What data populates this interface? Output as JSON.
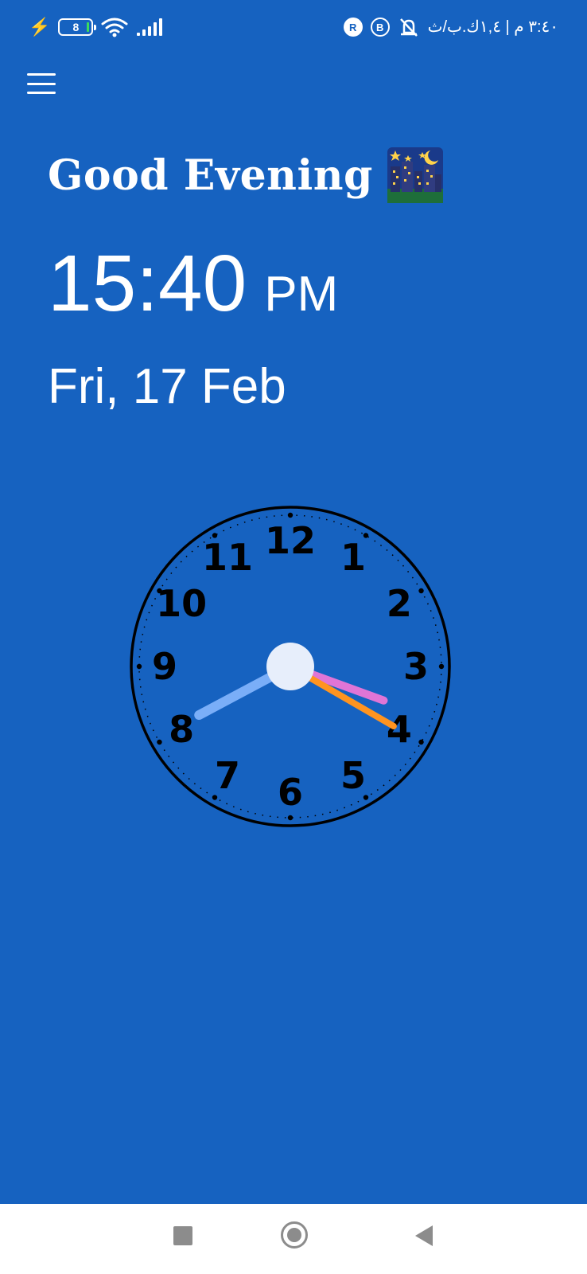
{
  "status_bar": {
    "battery_level": "8",
    "right_text": "٣:٤٠ م | ١,٤ك.ب/ث",
    "icons_left": [
      "charging-bolt-icon",
      "battery-icon",
      "wifi-icon",
      "cellular-signal-icon"
    ],
    "icons_right": [
      "muted-icon",
      "b-app-icon",
      "r-app-icon"
    ],
    "b_badge": "B",
    "r_badge": "R"
  },
  "header": {
    "menu_icon": "hamburger-menu-icon"
  },
  "greeting": {
    "text": "Good Evening",
    "emoji_icon": "night-city-icon"
  },
  "time": {
    "value": "15:40",
    "period": "PM"
  },
  "date": {
    "text": "Fri, 17 Feb"
  },
  "clock": {
    "hours": 15,
    "minutes": 40,
    "seconds": 20,
    "numbers": [
      "12",
      "1",
      "2",
      "3",
      "4",
      "5",
      "6",
      "7",
      "8",
      "9",
      "10",
      "11"
    ],
    "colors": {
      "hour_hand": "#E075D6",
      "minute_hand": "#7AAEF8",
      "second_hand": "#FF9420",
      "center": "#E7EEFB",
      "ticks": "#000000"
    }
  },
  "nav_bar": {
    "recent": "square-recent-icon",
    "home": "circle-home-icon",
    "back": "triangle-back-icon"
  },
  "colors": {
    "background": "#1662C0",
    "nav_background": "#FFFFFF"
  }
}
